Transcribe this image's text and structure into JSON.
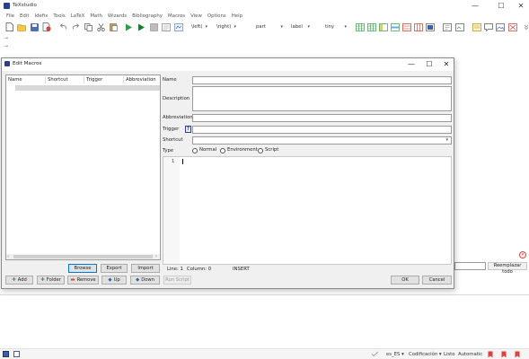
{
  "app": {
    "title": "TeXstudio",
    "window_controls": {
      "minimize": "—",
      "maximize": "☐",
      "close": "✕"
    }
  },
  "menubar": [
    "File",
    "Edit",
    "Idefix",
    "Tools",
    "LaTeX",
    "Math",
    "Wizards",
    "Bibliography",
    "Macros",
    "View",
    "Options",
    "Help"
  ],
  "toolbar": {
    "combos": [
      {
        "value": "\\left("
      },
      {
        "value": "\\right)"
      },
      {
        "value": "part"
      },
      {
        "value": "label"
      },
      {
        "value": "tiny"
      }
    ]
  },
  "background": {
    "replace_all_label": "Reemplazar todo"
  },
  "statusbar": {
    "language": "es_ES",
    "encoding_label": "Codificación",
    "status": "Listo",
    "mode": "Automatic"
  },
  "dialog": {
    "title": "Edit Macros",
    "window_controls": {
      "minimize": "—",
      "maximize": "☐",
      "close": "✕"
    },
    "table_headers": [
      "Name",
      "Shortcut",
      "Trigger",
      "Abbreviation"
    ],
    "buttons": {
      "browse": "Browse",
      "export": "Export",
      "import": "Import",
      "add": "Add",
      "folder": "Folder",
      "remove": "Remove",
      "up": "Up",
      "down": "Down",
      "run_script": "Run Script",
      "ok": "OK",
      "cancel": "Cancel"
    },
    "fields": {
      "name": "Name",
      "description": "Description",
      "abbreviation": "Abbreviation",
      "trigger": "Trigger",
      "trigger_help": "?",
      "shortcut": "Shortcut",
      "type": "Type"
    },
    "type_options": [
      "Normal",
      "Environment",
      "Script"
    ],
    "editor": {
      "line_number": "1"
    },
    "editor_status": {
      "line": "Line: 1",
      "column": "Column: 0",
      "mode": "INSERT"
    }
  }
}
